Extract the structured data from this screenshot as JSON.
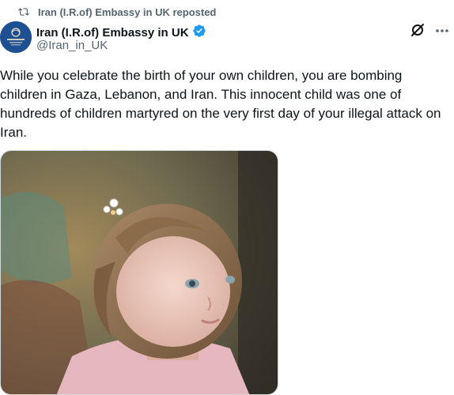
{
  "repost_line": {
    "text": "Iran (I.R.of) Embassy in UK reposted",
    "icon": "repost-icon"
  },
  "author": {
    "name": "Iran (I.R.of) Embassy in UK",
    "handle": "@Iran_in_UK",
    "verified_badge": "verified-badge-icon",
    "badge_color": "#1d9bf0"
  },
  "actions": {
    "grok": "grok-icon",
    "more": "more-icon"
  },
  "tweet": {
    "text": "While you celebrate the birth of your own children, you are bombing children in Gaza, Lebanon, and Iran. This innocent child was one of hundreds of children martyred on the very first day of your illegal attack on Iran."
  },
  "media": {
    "icon": "photo-of-toddler-with-hair-clip"
  }
}
